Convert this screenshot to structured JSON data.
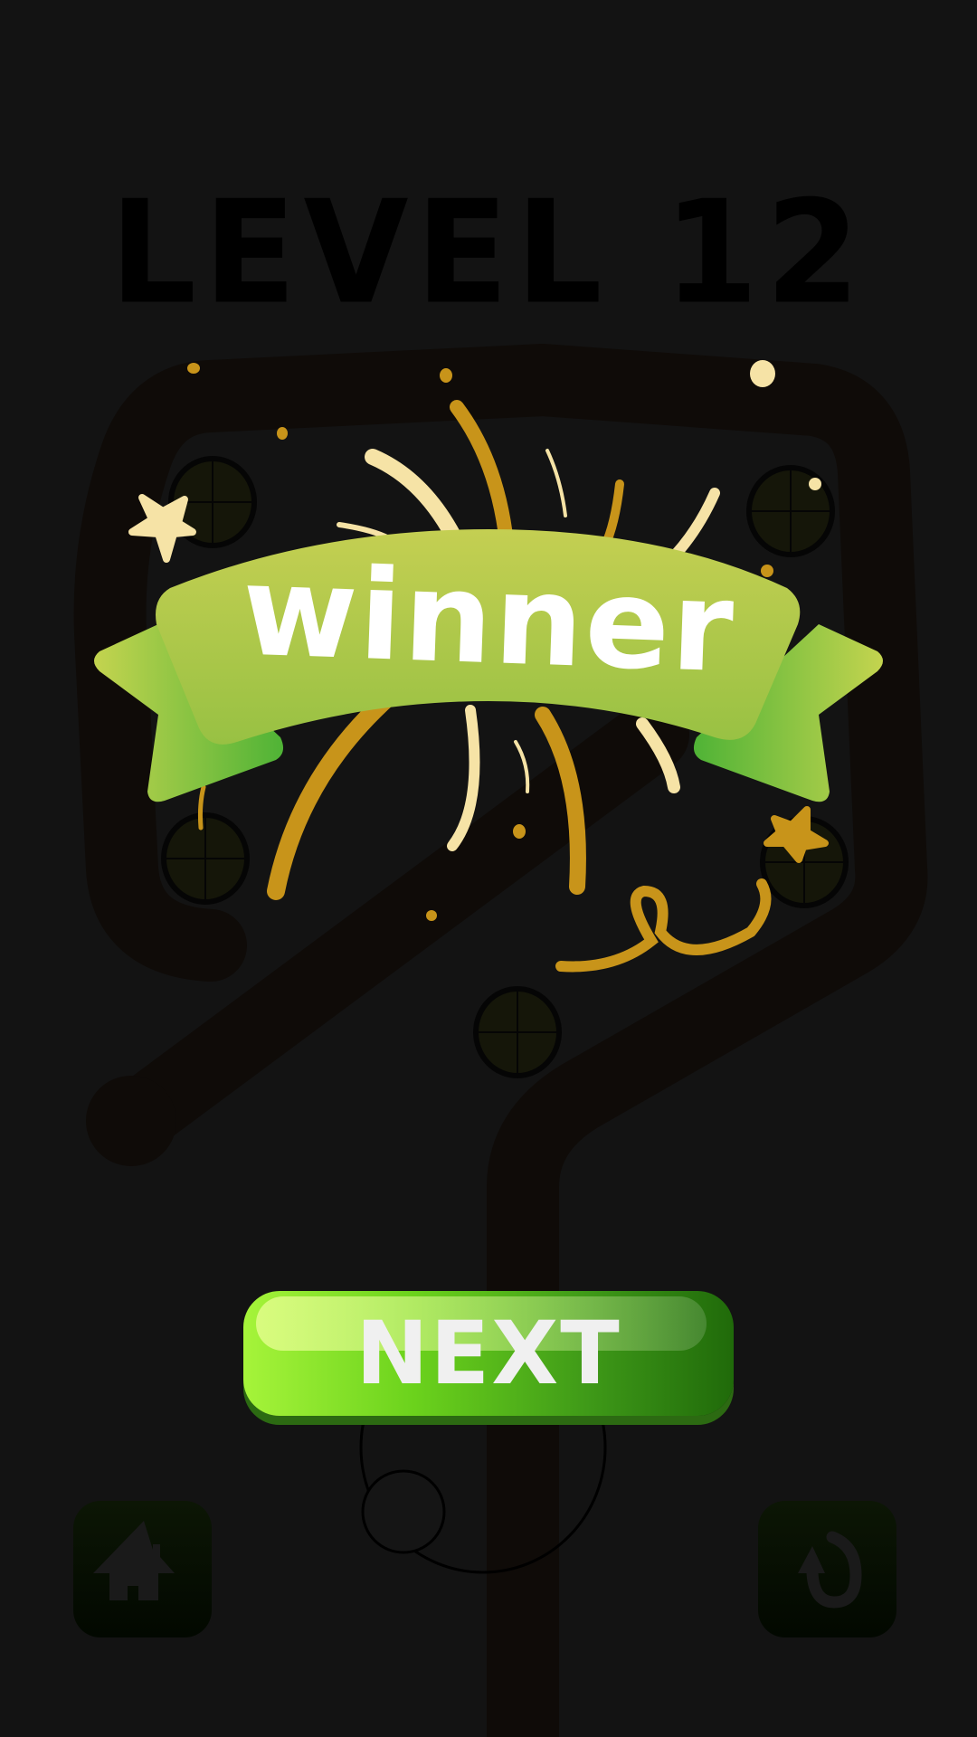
{
  "header": {
    "level_title": "LEVEL 12"
  },
  "banner": {
    "text": "winner"
  },
  "buttons": {
    "next_label": "NEXT",
    "home_icon": "home-icon",
    "restart_icon": "restart-icon"
  },
  "colors": {
    "background": "#131313",
    "track": "#0f0b08",
    "ribbon": "#a8c84a",
    "confetti_gold": "#c8941a",
    "confetti_cream": "#f6e3a6",
    "button_green": "#6bd21c"
  }
}
